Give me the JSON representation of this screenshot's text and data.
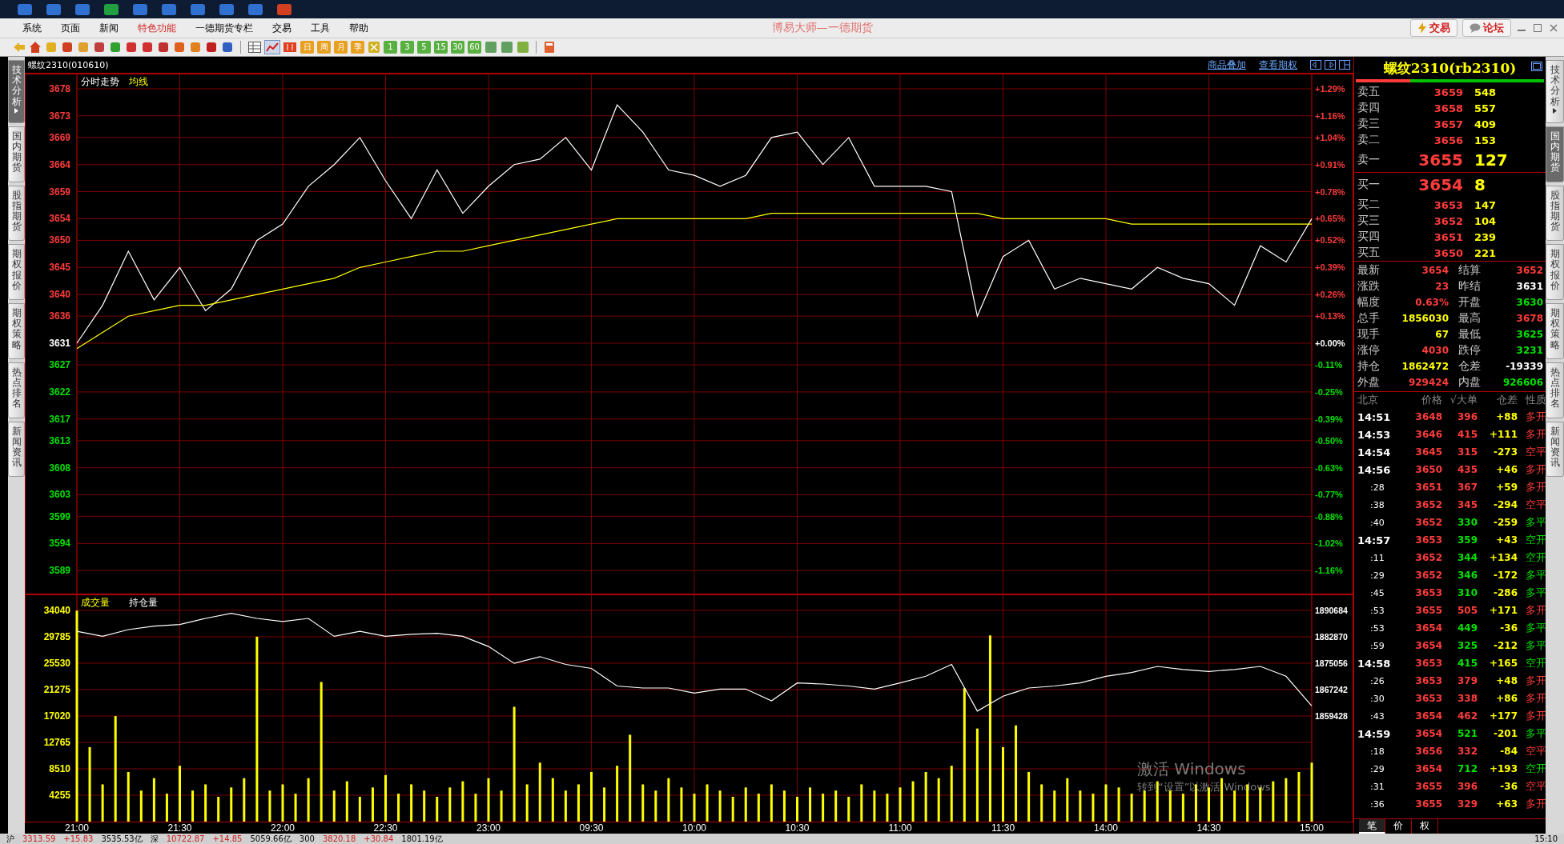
{
  "window": {
    "title": "博易大师—一德期货",
    "buttons": [
      {
        "label": "交易",
        "kind": "trade"
      },
      {
        "label": "论坛",
        "kind": "forum"
      }
    ]
  },
  "menu": [
    {
      "label": "系统",
      "highlight": false
    },
    {
      "label": "页面",
      "highlight": false
    },
    {
      "label": "新闻",
      "highlight": false
    },
    {
      "label": "特色功能",
      "highlight": true
    },
    {
      "label": "一德期货专栏",
      "highlight": false
    },
    {
      "label": "交易",
      "highlight": false
    },
    {
      "label": "工具",
      "highlight": false
    },
    {
      "label": "帮助",
      "highlight": false
    }
  ],
  "toolbar": {
    "periods": [
      {
        "label": "日",
        "kind": "calendar"
      },
      {
        "label": "周",
        "kind": "calendar"
      },
      {
        "label": "月",
        "kind": "calendar"
      },
      {
        "label": "季",
        "kind": "calendar"
      },
      {
        "label": "1",
        "kind": "minute"
      },
      {
        "label": "3",
        "kind": "minute"
      },
      {
        "label": "5",
        "kind": "minute"
      },
      {
        "label": "15",
        "kind": "minute"
      },
      {
        "label": "30",
        "kind": "minute"
      },
      {
        "label": "60",
        "kind": "minute"
      }
    ]
  },
  "left_tabs": [
    {
      "label": "技术分析",
      "selected": true,
      "arrow": true
    },
    {
      "label": "国内期货",
      "selected": false,
      "arrow": false
    },
    {
      "label": "股指期货",
      "selected": false,
      "arrow": false
    },
    {
      "label": "期权报价",
      "selected": false,
      "arrow": false
    },
    {
      "label": "期权策略",
      "selected": false,
      "arrow": false
    },
    {
      "label": "热点排名",
      "selected": false,
      "arrow": false
    },
    {
      "label": "新闻资讯",
      "selected": false,
      "arrow": false
    }
  ],
  "chart": {
    "instrument": "螺纹2310(010610)",
    "links": [
      "商品叠加",
      "查看期权"
    ],
    "price": {
      "chart_data": {
        "type": "line",
        "categories": [
          null,
          null,
          null,
          null,
          null,
          null,
          null,
          null,
          null,
          null,
          null,
          null,
          null,
          null,
          null,
          null,
          null,
          null,
          null,
          null,
          null,
          null,
          null,
          null,
          null,
          null,
          null,
          null,
          null,
          null,
          null,
          null,
          null,
          null,
          null,
          null,
          null,
          null,
          null,
          null,
          null,
          null,
          null,
          null,
          null,
          null,
          null,
          null,
          null
        ],
        "series": [
          {
            "name": "分时走势",
            "color": "#ffffff",
            "values": [
              3631,
              3638,
              3648,
              3639,
              3645,
              3637,
              3641,
              3650,
              3653,
              3660,
              3664,
              3669,
              3661,
              3654,
              3663,
              3655,
              3660,
              3664,
              3665,
              3669,
              3663,
              3675,
              3670,
              3663,
              3662,
              3660,
              3662,
              3669,
              3670,
              3664,
              3669,
              3660,
              3660,
              3660,
              3659,
              3636,
              3647,
              3650,
              3641,
              3643,
              3642,
              3641,
              3645,
              3643,
              3642,
              3638,
              3649,
              3646,
              3654
            ]
          },
          {
            "name": "均线",
            "color": "#ffff00",
            "values": [
              3630,
              3633,
              3636,
              3637,
              3638,
              3638,
              3639,
              3640,
              3641,
              3642,
              3643,
              3645,
              3646,
              3647,
              3648,
              3648,
              3649,
              3650,
              3651,
              3652,
              3653,
              3654,
              3654,
              3654,
              3654,
              3654,
              3654,
              3655,
              3655,
              3655,
              3655,
              3655,
              3655,
              3655,
              3655,
              3655,
              3654,
              3654,
              3654,
              3654,
              3654,
              3653,
              3653,
              3653,
              3653,
              3653,
              3653,
              3653,
              3653
            ]
          }
        ],
        "grid": true,
        "ylim": [
          3584.6,
          3680.8
        ],
        "yticks": [
          3678,
          3673,
          3669,
          3664,
          3659,
          3654,
          3650,
          3645,
          3640,
          3636,
          3631,
          3627,
          3622,
          3617,
          3613,
          3608,
          3603,
          3599,
          3594,
          3589
        ]
      },
      "right_labels": [
        "+1.29%",
        "+1.16%",
        "+1.04%",
        "+0.91%",
        "+0.78%",
        "+0.65%",
        "+0.52%",
        "+0.39%",
        "+0.26%",
        "+0.13%",
        "+0.00%",
        "-0.11%",
        "-0.25%",
        "-0.39%",
        "-0.50%",
        "-0.63%",
        "-0.77%",
        "-0.88%",
        "-1.02%",
        "-1.16%"
      ]
    },
    "volume": {
      "chart_data": {
        "type": "bar",
        "categories": [
          "21:00",
          null,
          null,
          null,
          null,
          null,
          null,
          null,
          "21:30",
          null,
          null,
          null,
          null,
          null,
          null,
          null,
          "22:00",
          null,
          null,
          null,
          null,
          null,
          null,
          null,
          "22:30",
          null,
          null,
          null,
          null,
          null,
          null,
          null,
          "23:00",
          null,
          null,
          null,
          null,
          null,
          null,
          null,
          "09:30",
          null,
          null,
          null,
          null,
          null,
          null,
          null,
          "10:00",
          null,
          null,
          null,
          null,
          null,
          null,
          null,
          "10:30",
          null,
          null,
          null,
          null,
          null,
          null,
          null,
          "11:00",
          null,
          null,
          null,
          null,
          null,
          null,
          null,
          "11:30",
          null,
          null,
          null,
          null,
          null,
          null,
          null,
          "14:00",
          null,
          null,
          null,
          null,
          null,
          null,
          null,
          "14:30",
          null,
          null,
          null,
          null,
          null,
          null,
          null,
          "15:00"
        ],
        "series": [
          {
            "name": "成交量",
            "color": "#ffff00",
            "values": [
              34000,
              12000,
              6000,
              17000,
              8000,
              5000,
              7000,
              4500,
              9000,
              5000,
              6000,
              4000,
              5500,
              7000,
              29800,
              5000,
              6000,
              4500,
              7000,
              22500,
              5000,
              6500,
              4000,
              5500,
              7500,
              4500,
              6000,
              5000,
              4000,
              5500,
              6500,
              4500,
              7000,
              5000,
              18500,
              6000,
              9500,
              7000,
              5000,
              6000,
              8000,
              5500,
              9000,
              14000,
              6000,
              5000,
              7000,
              5500,
              4500,
              6000,
              5000,
              4000,
              5500,
              4500,
              6000,
              5000,
              4000,
              5500,
              4500,
              5000,
              4000,
              6000,
              5000,
              4500,
              5500,
              6500,
              8000,
              7000,
              9000,
              21500,
              15000,
              30000,
              12000,
              15500,
              8000,
              6000,
              5000,
              7000,
              5000,
              4500,
              6000,
              5500,
              4500,
              5000,
              6500,
              5000,
              4500,
              6000,
              5500,
              7000,
              5000,
              6000,
              5500,
              6500,
              7000,
              8000,
              9500
            ]
          }
        ],
        "grid": true,
        "ylim": [
          0,
          36614
        ],
        "yticks": [
          4255,
          8510,
          12765,
          17020,
          21275,
          25530,
          29785,
          34040
        ]
      }
    },
    "open_interest": {
      "chart_data": {
        "type": "line",
        "categories": [
          null,
          null,
          null,
          null,
          null,
          null,
          null,
          null,
          null,
          null,
          null,
          null,
          null,
          null,
          null,
          null,
          null,
          null,
          null,
          null,
          null,
          null,
          null,
          null,
          null,
          null,
          null,
          null,
          null,
          null,
          null,
          null,
          null,
          null,
          null,
          null,
          null,
          null,
          null,
          null,
          null,
          null,
          null,
          null,
          null,
          null,
          null,
          null,
          null
        ],
        "series": [
          {
            "name": "持仓量",
            "color": "#ffffff",
            "values": [
              1884500,
              1883000,
              1885000,
              1886000,
              1886500,
              1888300,
              1889800,
              1888300,
              1887400,
              1888300,
              1883000,
              1884500,
              1883000,
              1883600,
              1883900,
              1883000,
              1880000,
              1875000,
              1877000,
              1874700,
              1873500,
              1868300,
              1867700,
              1867700,
              1866200,
              1867400,
              1867400,
              1863900,
              1869200,
              1868900,
              1868300,
              1867400,
              1869200,
              1871200,
              1874700,
              1860900,
              1865300,
              1867700,
              1868300,
              1869200,
              1871200,
              1872300,
              1874100,
              1873200,
              1872600,
              1873200,
              1874100,
              1871200,
              1862400
            ]
          }
        ],
        "grid": false,
        "ylim": [
          1859428,
          1890684
        ],
        "yticks": [
          1859428,
          1867242,
          1875056,
          1882870,
          1890684
        ]
      }
    }
  },
  "quote": {
    "title": "螺纹2310(rb2310)",
    "ratio_bar": {
      "level": 0.29
    },
    "order_book": [
      {
        "label": "卖五",
        "price": "3659",
        "volume": "548",
        "best": false
      },
      {
        "label": "卖四",
        "price": "3658",
        "volume": "557",
        "best": false
      },
      {
        "label": "卖三",
        "price": "3657",
        "volume": "409",
        "best": false
      },
      {
        "label": "卖二",
        "price": "3656",
        "volume": "153",
        "best": false
      },
      {
        "label": "卖一",
        "price": "3655",
        "volume": "127",
        "best": true
      },
      {
        "label": "买一",
        "price": "3654",
        "volume": "8",
        "best": true
      },
      {
        "label": "买二",
        "price": "3653",
        "volume": "147",
        "best": false
      },
      {
        "label": "买三",
        "price": "3652",
        "volume": "104",
        "best": false
      },
      {
        "label": "买四",
        "price": "3651",
        "volume": "239",
        "best": false
      },
      {
        "label": "买五",
        "price": "3650",
        "volume": "221",
        "best": false
      }
    ],
    "stats": [
      {
        "left": {
          "label": "最新",
          "value": "3654",
          "color": "#ff3c3c"
        },
        "right": {
          "label": "结算",
          "value": "3652",
          "color": "#ff3c3c"
        }
      },
      {
        "left": {
          "label": "涨跌",
          "value": "23",
          "color": "#ff3c3c"
        },
        "right": {
          "label": "昨结",
          "value": "3631",
          "color": "#ffffff"
        }
      },
      {
        "left": {
          "label": "幅度",
          "value": "0.63%",
          "color": "#ff3c3c"
        },
        "right": {
          "label": "开盘",
          "value": "3630",
          "color": "#00e000"
        }
      },
      {
        "left": {
          "label": "总手",
          "value": "1856030",
          "color": "#ffff00"
        },
        "right": {
          "label": "最高",
          "value": "3678",
          "color": "#ff3c3c"
        }
      },
      {
        "left": {
          "label": "现手",
          "value": "67",
          "color": "#ffff00"
        },
        "right": {
          "label": "最低",
          "value": "3625",
          "color": "#00e000"
        }
      },
      {
        "left": {
          "label": "涨停",
          "value": "4030",
          "color": "#ff3c3c"
        },
        "right": {
          "label": "跌停",
          "value": "3231",
          "color": "#00e000"
        }
      },
      {
        "left": {
          "label": "持仓",
          "value": "1862472",
          "color": "#ffff00"
        },
        "right": {
          "label": "仓差",
          "value": "-19339",
          "color": "#ffffff"
        }
      },
      {
        "left": {
          "label": "外盘",
          "value": "929424",
          "color": "#ff3c3c"
        },
        "right": {
          "label": "内盘",
          "value": "926606",
          "color": "#00e000"
        }
      }
    ],
    "trades_header": [
      "北京",
      "价格",
      "√大单",
      "仓差",
      "性质"
    ],
    "trades": [
      {
        "time": "14:51",
        "kind": "minute",
        "price": "3648",
        "volume": "396",
        "oi_change": "+88",
        "nature": "多开",
        "color": "#ff3c3c"
      },
      {
        "time": "14:53",
        "kind": "minute",
        "price": "3646",
        "volume": "415",
        "oi_change": "+111",
        "nature": "多开",
        "color": "#ff3c3c"
      },
      {
        "time": "14:54",
        "kind": "minute",
        "price": "3645",
        "volume": "315",
        "oi_change": "-273",
        "nature": "空平",
        "color": "#ff3c3c"
      },
      {
        "time": "14:56",
        "kind": "minute",
        "price": "3650",
        "volume": "435",
        "oi_change": "+46",
        "nature": "多开",
        "color": "#ff3c3c"
      },
      {
        "time": ":28",
        "kind": "second",
        "price": "3651",
        "volume": "367",
        "oi_change": "+59",
        "nature": "多开",
        "color": "#ff3c3c"
      },
      {
        "time": ":38",
        "kind": "second",
        "price": "3652",
        "volume": "345",
        "oi_change": "-294",
        "nature": "空平",
        "color": "#ff3c3c"
      },
      {
        "time": ":40",
        "kind": "second",
        "price": "3652",
        "volume": "330",
        "oi_change": "-259",
        "nature": "多平",
        "color": "#00e000"
      },
      {
        "time": "14:57",
        "kind": "minute",
        "price": "3653",
        "volume": "359",
        "oi_change": "+43",
        "nature": "空开",
        "color": "#00e000"
      },
      {
        "time": ":11",
        "kind": "second",
        "price": "3652",
        "volume": "344",
        "oi_change": "+134",
        "nature": "空开",
        "color": "#00e000"
      },
      {
        "time": ":29",
        "kind": "second",
        "price": "3652",
        "volume": "346",
        "oi_change": "-172",
        "nature": "多平",
        "color": "#00e000"
      },
      {
        "time": ":45",
        "kind": "second",
        "price": "3653",
        "volume": "310",
        "oi_change": "-286",
        "nature": "多平",
        "color": "#00e000"
      },
      {
        "time": ":53",
        "kind": "second",
        "price": "3655",
        "volume": "505",
        "oi_change": "+171",
        "nature": "多开",
        "color": "#ff3c3c"
      },
      {
        "time": ":53",
        "kind": "second",
        "price": "3654",
        "volume": "449",
        "oi_change": "-36",
        "nature": "多平",
        "color": "#00e000"
      },
      {
        "time": ":59",
        "kind": "second",
        "price": "3654",
        "volume": "325",
        "oi_change": "-212",
        "nature": "多平",
        "color": "#00e000"
      },
      {
        "time": "14:58",
        "kind": "minute",
        "price": "3653",
        "volume": "415",
        "oi_change": "+165",
        "nature": "空开",
        "color": "#00e000"
      },
      {
        "time": ":26",
        "kind": "second",
        "price": "3653",
        "volume": "379",
        "oi_change": "+48",
        "nature": "多开",
        "color": "#ff3c3c"
      },
      {
        "time": ":30",
        "kind": "second",
        "price": "3653",
        "volume": "338",
        "oi_change": "+86",
        "nature": "多开",
        "color": "#ff3c3c"
      },
      {
        "time": ":43",
        "kind": "second",
        "price": "3654",
        "volume": "462",
        "oi_change": "+177",
        "nature": "多开",
        "color": "#ff3c3c"
      },
      {
        "time": "14:59",
        "kind": "minute",
        "price": "3654",
        "volume": "521",
        "oi_change": "-201",
        "nature": "多平",
        "color": "#00e000"
      },
      {
        "time": ":18",
        "kind": "second",
        "price": "3656",
        "volume": "332",
        "oi_change": "-84",
        "nature": "空平",
        "color": "#ff3c3c"
      },
      {
        "time": ":29",
        "kind": "second",
        "price": "3654",
        "volume": "712",
        "oi_change": "+193",
        "nature": "空开",
        "color": "#00e000"
      },
      {
        "time": ":31",
        "kind": "second",
        "price": "3655",
        "volume": "396",
        "oi_change": "-36",
        "nature": "空平",
        "color": "#ff3c3c"
      },
      {
        "time": ":36",
        "kind": "second",
        "price": "3655",
        "volume": "329",
        "oi_change": "+63",
        "nature": "多开",
        "color": "#ff3c3c"
      }
    ],
    "tabs": [
      {
        "label": "笔",
        "selected": true
      },
      {
        "label": "价",
        "selected": false
      },
      {
        "label": "权",
        "selected": false
      }
    ]
  },
  "right_tabs": [
    {
      "label": "技术分析",
      "selected": false,
      "arrow": true
    },
    {
      "label": "国内期货",
      "selected": true,
      "arrow": false
    },
    {
      "label": "股指期货",
      "selected": false,
      "arrow": false
    },
    {
      "label": "期权报价",
      "selected": false,
      "arrow": false
    },
    {
      "label": "期权策略",
      "selected": false,
      "arrow": false
    },
    {
      "label": "热点排名",
      "selected": false,
      "arrow": false
    },
    {
      "label": "新闻资讯",
      "selected": false,
      "arrow": false
    }
  ],
  "activation_notice": {
    "title": "激活 Windows",
    "text": "转到“设置”以激活 Windows。"
  },
  "status_bar": {
    "indices": [
      {
        "label": "沪",
        "value": "3313.59",
        "change": "+15.83",
        "amount": "3535.53亿"
      },
      {
        "label": "深",
        "value": "10722.87",
        "change": "+14.85",
        "amount": "5059.66亿"
      },
      {
        "label": "300",
        "value": "3820.18",
        "change": "+30.84",
        "amount": "1801.19亿"
      }
    ],
    "clock": "15:10"
  }
}
